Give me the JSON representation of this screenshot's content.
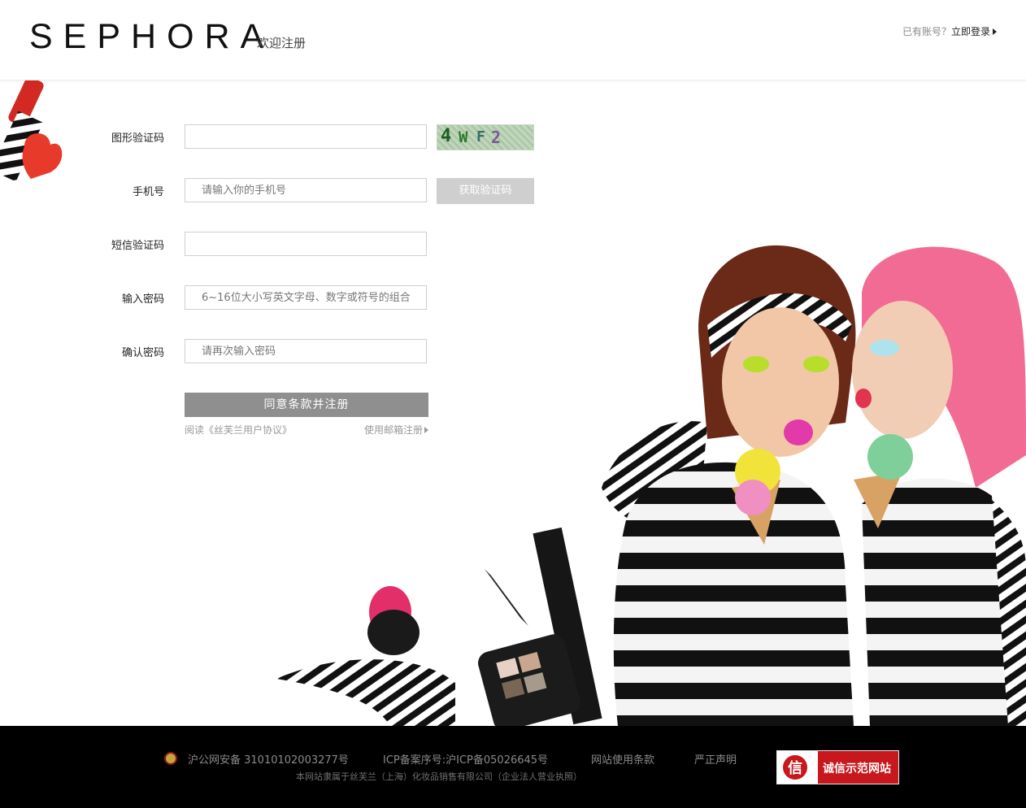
{
  "header": {
    "logo": "SEPHORA",
    "subtitle": "欢迎注册",
    "login_prompt": "已有账号？",
    "login_link": "立即登录"
  },
  "form": {
    "captcha_label": "图形验证码",
    "captcha_text": [
      "4",
      "W",
      "F",
      "2"
    ],
    "phone_label": "手机号",
    "phone_placeholder": "请输入你的手机号",
    "sms_button": "获取验证码",
    "sms_label": "短信验证码",
    "password_label": "输入密码",
    "password_placeholder": "6~16位大小写英文字母、数字或符号的组合",
    "confirm_label": "确认密码",
    "confirm_placeholder": "请再次输入密码",
    "submit": "同意条款并注册",
    "agreement": "阅读《丝芙兰用户协议》",
    "email_register": "使用邮箱注册"
  },
  "footer": {
    "police": "沪公网安备 31010102003277号",
    "icp": "ICP备案序号:沪ICP备05026645号",
    "terms": "网站使用条款",
    "statement": "严正声明",
    "company": "本网站隶属于丝芙兰（上海）化妆品销售有限公司（企业法人营业执照）",
    "badge": "诚信示范网站"
  },
  "colors": {
    "submit_bg": "#8f8f8f",
    "sms_bg": "#cfcfcf",
    "footer_bg": "#000000",
    "badge_red": "#c8171d"
  }
}
